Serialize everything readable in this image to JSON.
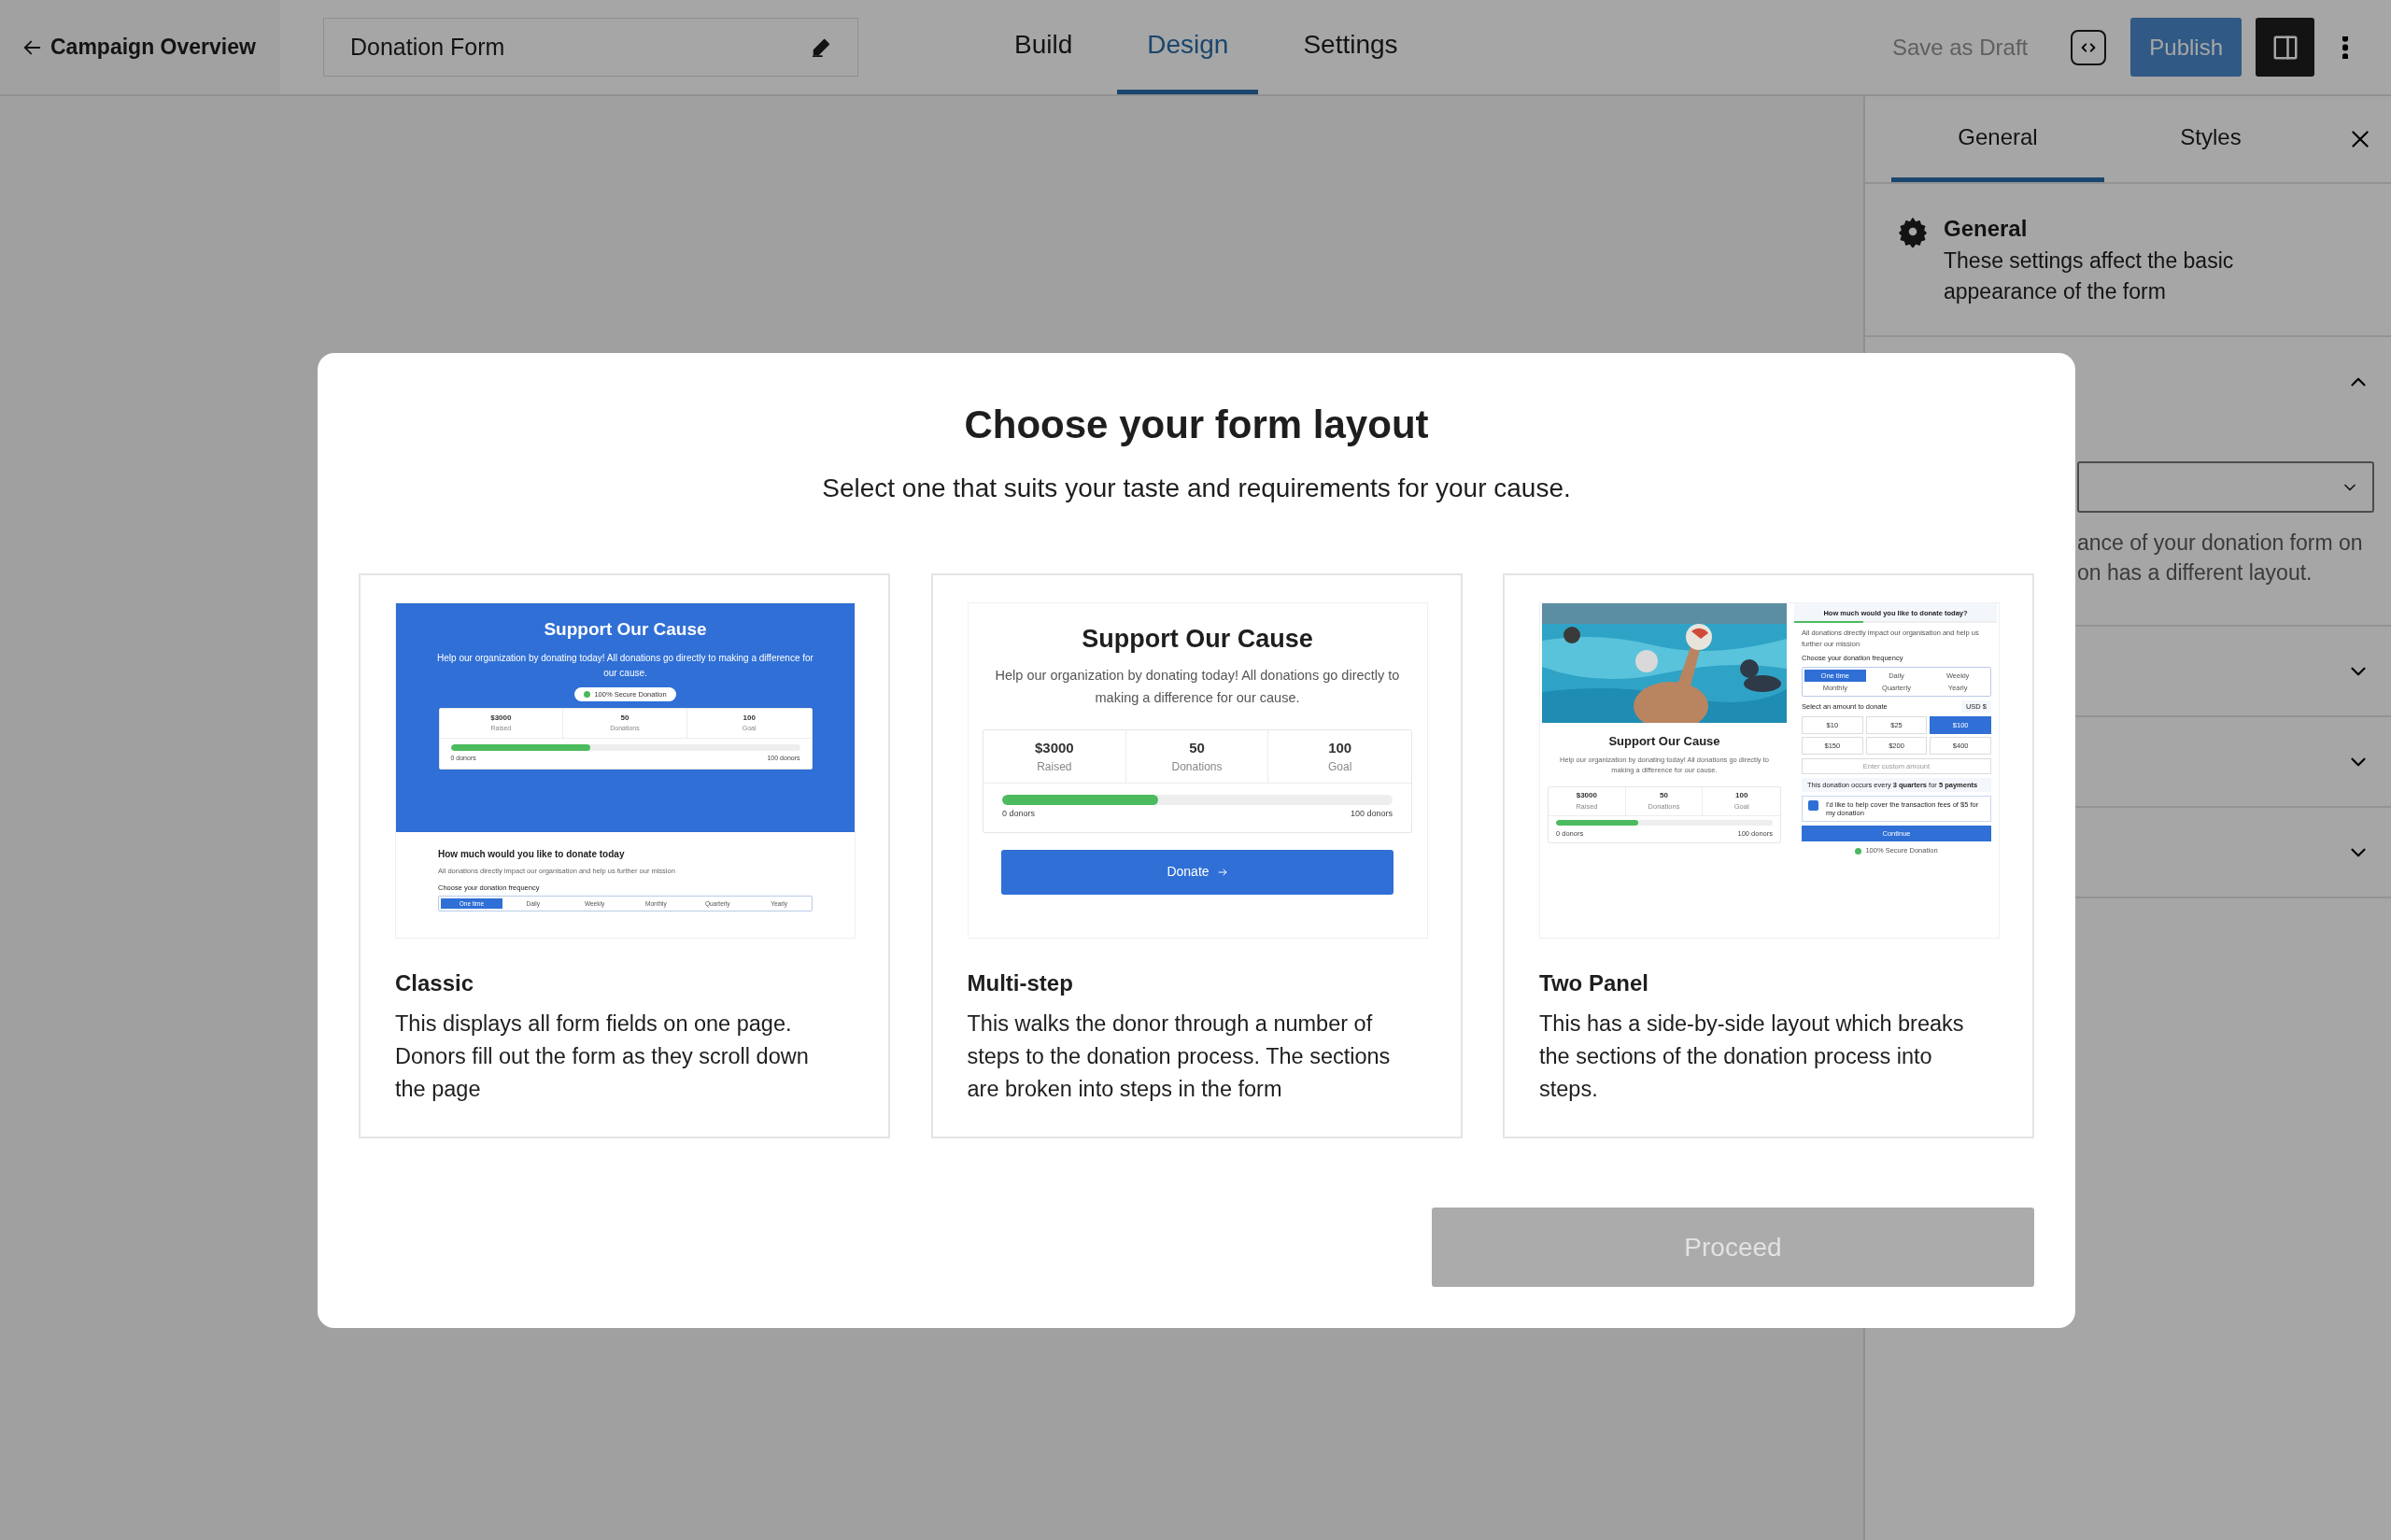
{
  "header": {
    "back_link": "Campaign Overview",
    "form_title": "Donation Form",
    "tabs": [
      {
        "label": "Build",
        "selected": false
      },
      {
        "label": "Design",
        "selected": true
      },
      {
        "label": "Settings",
        "selected": false
      }
    ],
    "save_draft": {
      "label": "Save as Draft",
      "disabled": true
    },
    "publish": "Publish",
    "sidebar_toggle": {
      "on": true
    }
  },
  "sidebar": {
    "tabs": [
      {
        "label": "General",
        "selected": true
      },
      {
        "label": "Styles",
        "selected": false
      }
    ],
    "section": {
      "title": "General",
      "description": "These settings affect the basic appearance of the form"
    },
    "panels": [
      {
        "expanded": true,
        "help_lines": [
          "ance of your donation form on",
          "on has a different layout."
        ]
      },
      {
        "expanded": false
      },
      {
        "expanded": false
      },
      {
        "expanded": false
      }
    ]
  },
  "modal": {
    "title": "Choose your form layout",
    "subtitle": "Select one that suits your taste and requirements for your cause.",
    "layouts": [
      {
        "kind": "classic",
        "name": "Classic",
        "selected": false,
        "description": "This displays all form fields on one page. Donors fill out the form as they scroll down the page",
        "preview": {
          "heading": "Support Our Cause",
          "intro": "Help our organization by donating today! All donations go directly to making a difference for our cause.",
          "badge": "100% Secure Donation",
          "stats": [
            {
              "value": "$3000",
              "label": "Raised"
            },
            {
              "value": "50",
              "label": "Donations"
            },
            {
              "value": "100",
              "label": "Goal"
            }
          ],
          "progress": {
            "level": 0.4,
            "start": "0 donors",
            "end": "100 donors"
          },
          "question": "How much would you like to donate today",
          "note": "All donations directly impact our organisation and help us further our mission",
          "frequency_label": "Choose your donation frequency",
          "frequencies": [
            {
              "label": "One time",
              "selected": true
            },
            {
              "label": "Daily",
              "selected": false
            },
            {
              "label": "Weekly",
              "selected": false
            },
            {
              "label": "Monthly",
              "selected": false
            },
            {
              "label": "Quarterly",
              "selected": false
            },
            {
              "label": "Yearly",
              "selected": false
            }
          ]
        }
      },
      {
        "kind": "multistep",
        "name": "Multi-step",
        "selected": false,
        "description": "This walks the donor through a number of steps to the donation process. The sections are broken into steps in the form",
        "preview": {
          "heading": "Support Our Cause",
          "intro": "Help our organization by donating today! All donations go directly to making a difference for our cause.",
          "stats": [
            {
              "value": "$3000",
              "label": "Raised"
            },
            {
              "value": "50",
              "label": "Donations"
            },
            {
              "value": "100",
              "label": "Goal"
            }
          ],
          "progress": {
            "level": 0.4,
            "start": "0 donors",
            "end": "100 donors"
          },
          "button": "Donate"
        }
      },
      {
        "kind": "twopanel",
        "name": "Two Panel",
        "selected": false,
        "description": "This has a side-by-side layout which breaks the sections of the donation process into steps.",
        "preview": {
          "heading": "Support Our Cause",
          "intro": "Help our organization by donating today! All donations go directly to making a difference for our cause.",
          "stats": [
            {
              "value": "$3000",
              "label": "Raised"
            },
            {
              "value": "50",
              "label": "Donations"
            },
            {
              "value": "100",
              "label": "Goal"
            }
          ],
          "progress": {
            "level": 0.38,
            "start": "0 donors",
            "end": "100 donors"
          },
          "question": "How much would you like to donate today?",
          "step_progress": {
            "level": 0.34
          },
          "note": "All donations directly impact our organisation and help us further our mission",
          "frequency_label": "Choose your donation frequency",
          "frequencies": [
            {
              "label": "One time",
              "selected": true
            },
            {
              "label": "Daily",
              "selected": false
            },
            {
              "label": "Weekly",
              "selected": false
            },
            {
              "label": "Monthly",
              "selected": false
            },
            {
              "label": "Quarterly",
              "selected": false
            },
            {
              "label": "Yearly",
              "selected": false
            }
          ],
          "amount_label": "Select an amount to donate",
          "currency": "USD $",
          "amounts": [
            {
              "label": "$10",
              "selected": false
            },
            {
              "label": "$25",
              "selected": false
            },
            {
              "label": "$100",
              "selected": true
            },
            {
              "label": "$150",
              "selected": false
            },
            {
              "label": "$200",
              "selected": false
            },
            {
              "label": "$400",
              "selected": false
            }
          ],
          "custom_placeholder": "Enter custom amount",
          "recurrence": "This donation occurs every **3 quarters** for **5 payments**",
          "fee_option": {
            "label": "I'd like to help cover the transaction fees of $5 for my donation",
            "checked": true
          },
          "continue": "Continue",
          "secure": "100% Secure Donation"
        }
      }
    ],
    "proceed": {
      "label": "Proceed",
      "disabled": true
    }
  }
}
